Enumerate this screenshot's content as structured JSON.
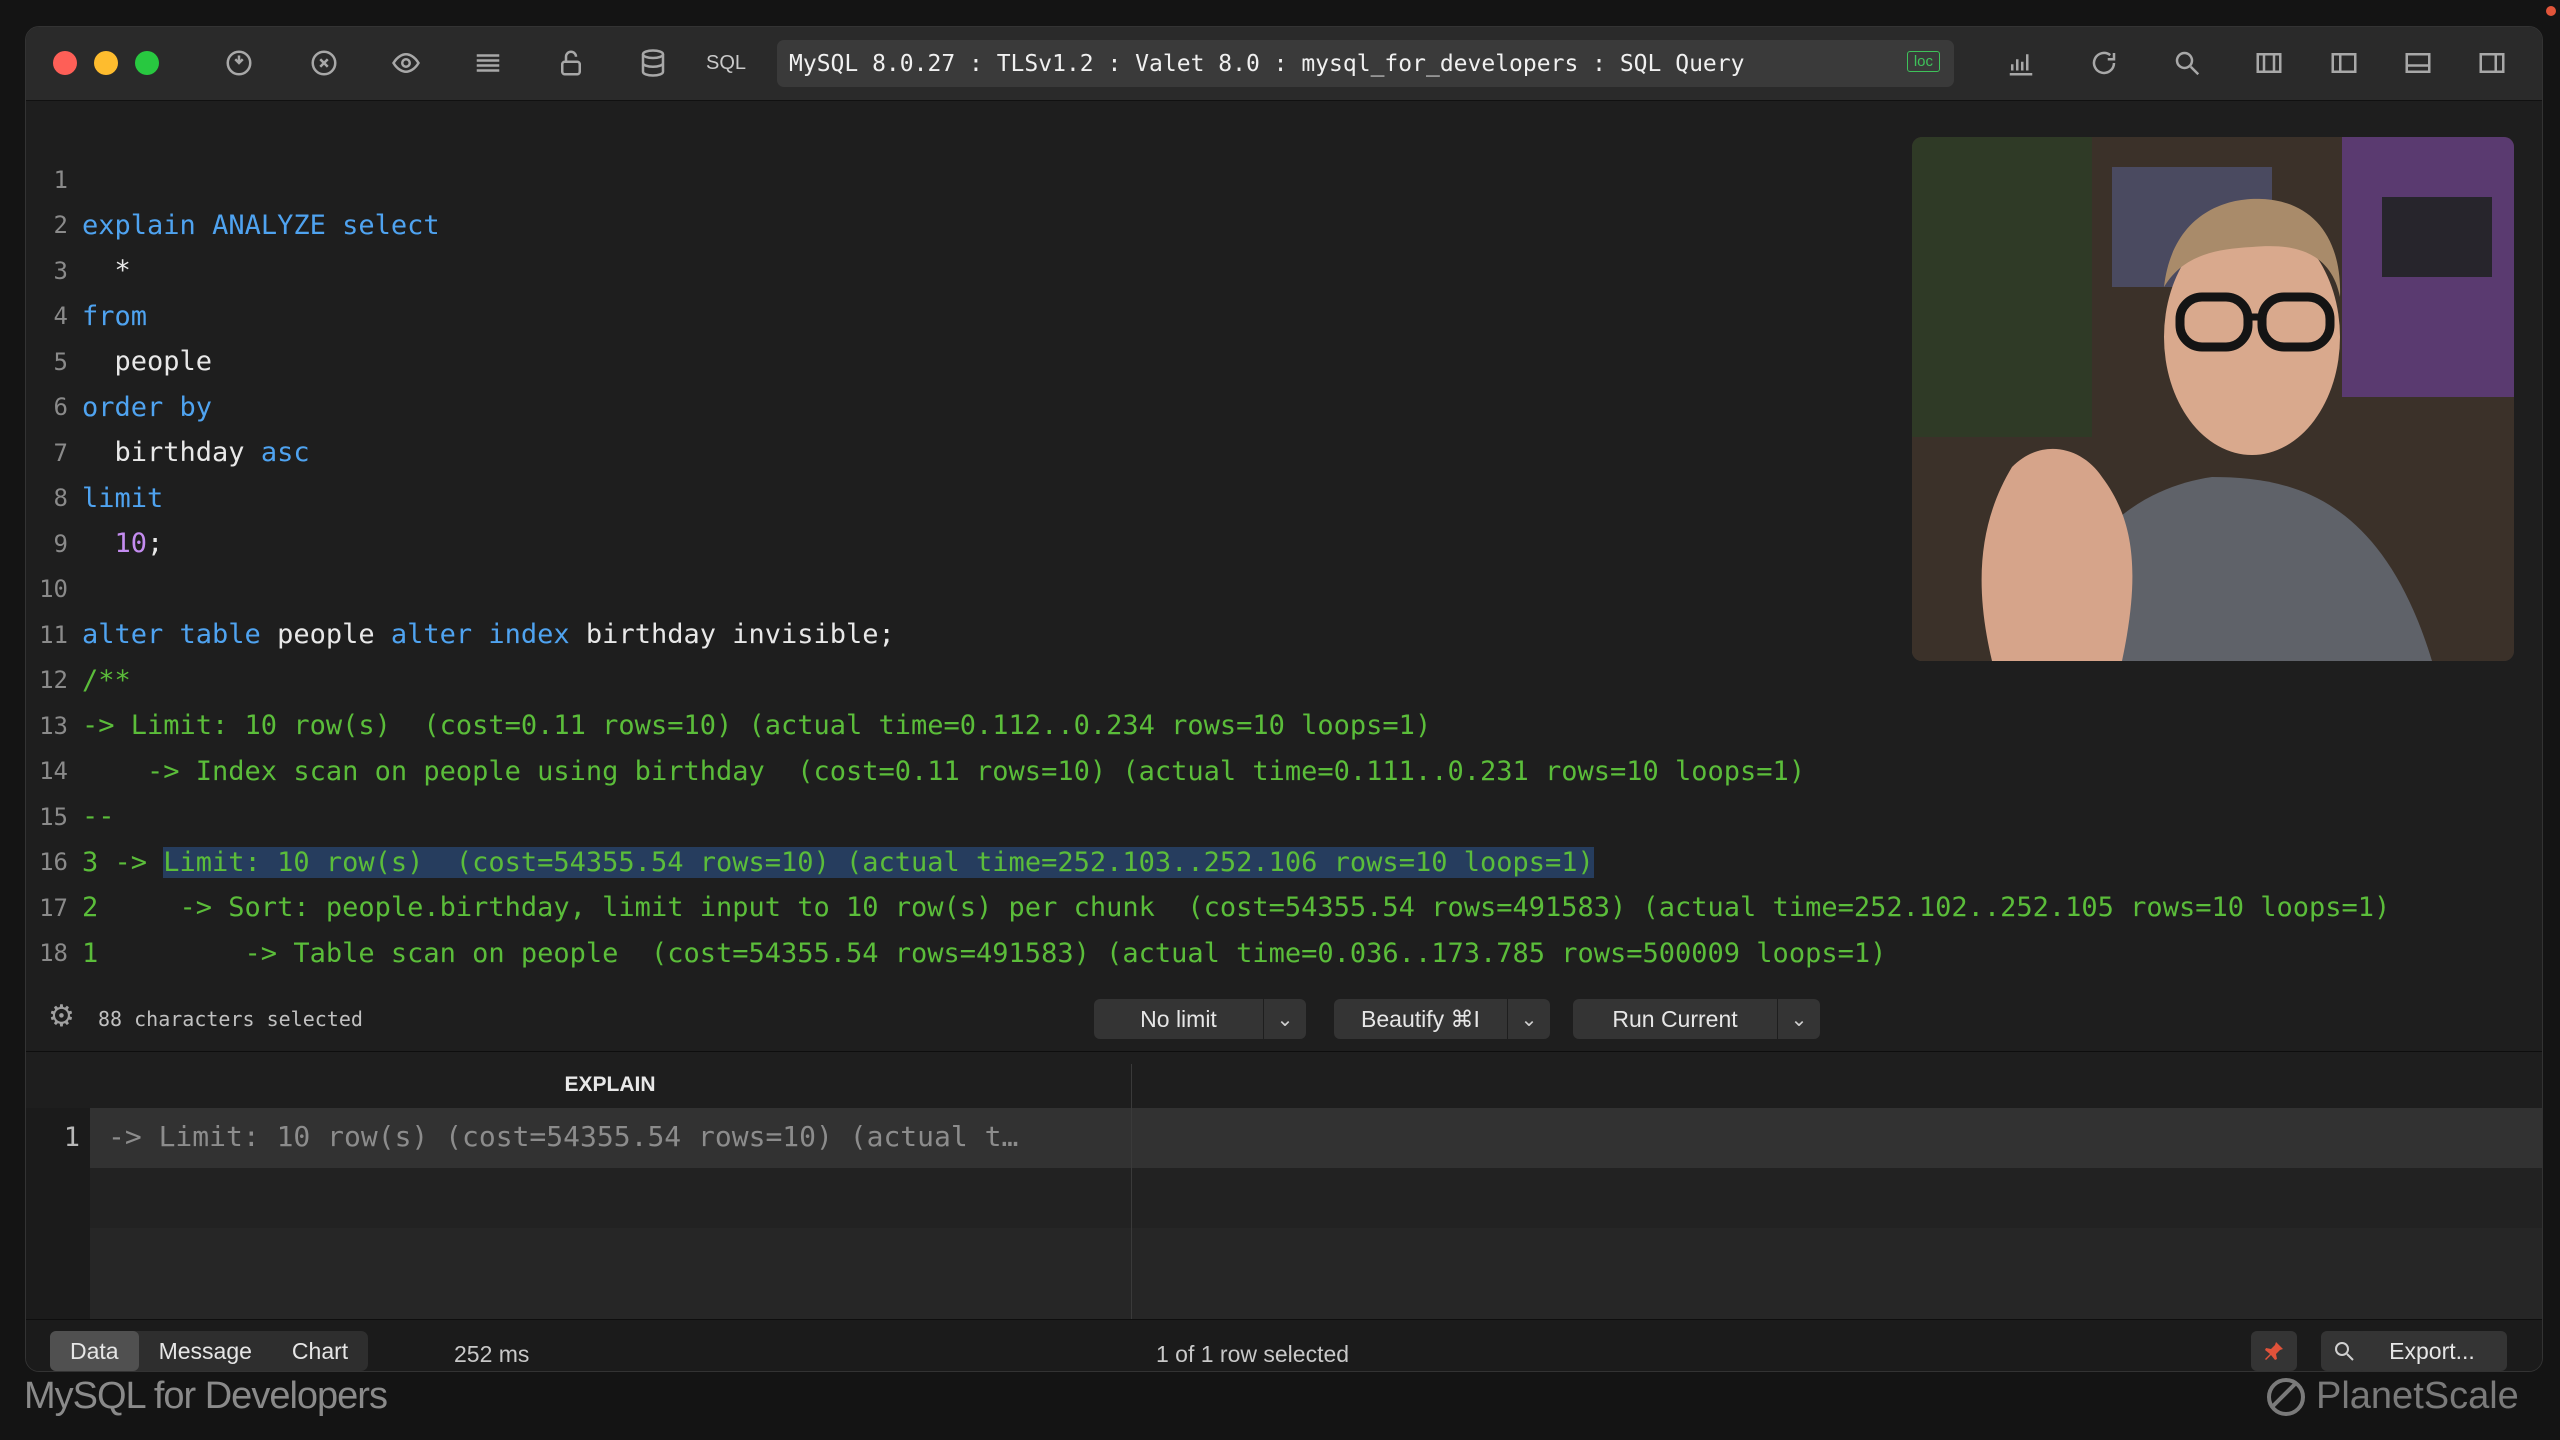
{
  "titlebar": {
    "sql_label": "SQL",
    "connection": "MySQL 8.0.27 : TLSv1.2 : Valet 8.0 : mysql_for_developers : SQL Query",
    "badge": "loc"
  },
  "editor": {
    "lines": [
      {
        "n": "1"
      },
      {
        "n": "2"
      },
      {
        "n": "3"
      },
      {
        "n": "4"
      },
      {
        "n": "5"
      },
      {
        "n": "6"
      },
      {
        "n": "7"
      },
      {
        "n": "8"
      },
      {
        "n": "9"
      },
      {
        "n": "10"
      },
      {
        "n": "11"
      },
      {
        "n": "12"
      },
      {
        "n": "13"
      },
      {
        "n": "14"
      },
      {
        "n": "15"
      },
      {
        "n": "16"
      },
      {
        "n": "17"
      },
      {
        "n": "18"
      }
    ],
    "l1_a": "explain",
    "l1_b": "ANALYZE",
    "l1_c": "select",
    "l2": "  *",
    "l3": "from",
    "l4": "  people",
    "l5": "order by",
    "l6_a": "  birthday ",
    "l6_b": "asc",
    "l7": "limit",
    "l8_a": "10",
    "l8_b": ";",
    "l10_a": "alter table",
    "l10_b": " people ",
    "l10_c": "alter index",
    "l10_d": " birthday invisible;",
    "l11": "/**",
    "l12": "-> Limit: 10 row(s)  (cost=0.11 rows=10) (actual time=0.112..0.234 rows=10 loops=1)",
    "l13": "    -> Index scan on people using birthday  (cost=0.11 rows=10) (actual time=0.111..0.231 rows=10 loops=1)",
    "l14": "--",
    "l15_a": "3 -> ",
    "l15_b": "Limit: 10 row(s)  (cost=54355.54 rows=10) (actual time=252.103..252.106 rows=10 loops=1)",
    "l16": "2     -> Sort: people.birthday, limit input to 10 row(s) per chunk  (cost=54355.54 rows=491583) (actual time=252.102..252.105 rows=10 loops=1)",
    "l17": "1         -> Table scan on people  (cost=54355.54 rows=491583) (actual time=0.036..173.785 rows=500009 loops=1)"
  },
  "footer": {
    "selection": "88 characters selected",
    "limit": "No limit",
    "beautify": "Beautify ⌘I",
    "run": "Run Current"
  },
  "results": {
    "header": "EXPLAIN",
    "row_num": "1",
    "row_value": "-> Limit: 10 row(s)  (cost=54355.54 rows=10) (actual t…"
  },
  "status": {
    "tabs": [
      "Data",
      "Message",
      "Chart"
    ],
    "elapsed": "252 ms",
    "selection": "1 of 1 row selected",
    "export": "Export..."
  },
  "branding": {
    "left": "MySQL for Developers",
    "right": "PlanetScale"
  }
}
